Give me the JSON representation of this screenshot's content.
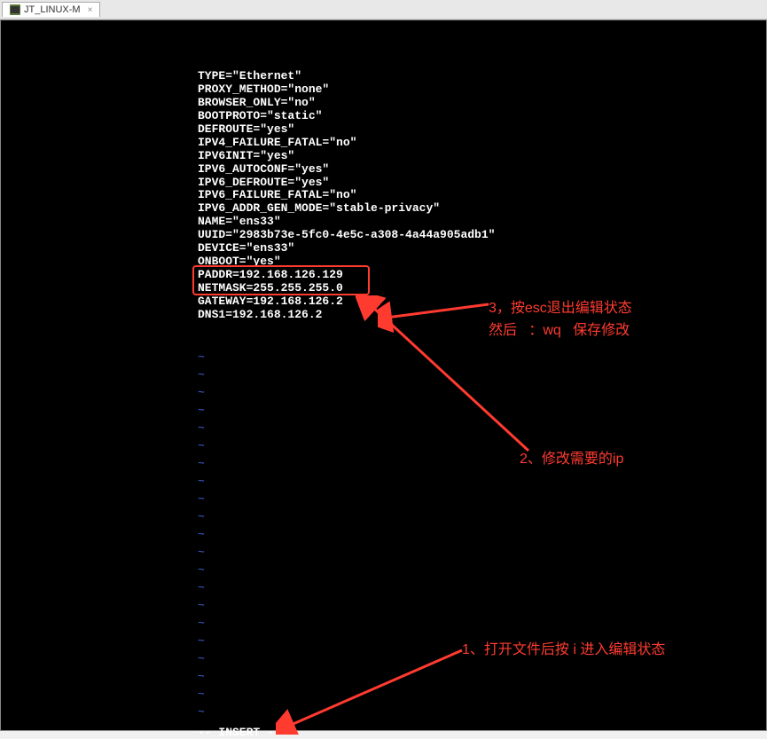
{
  "tab": {
    "label": "JT_LINUX-M",
    "close": "×"
  },
  "config": {
    "line1": "TYPE=\"Ethernet\"",
    "line2": "PROXY_METHOD=\"none\"",
    "line3": "BROWSER_ONLY=\"no\"",
    "line4": "BOOTPROTO=\"static\"",
    "line5": "DEFROUTE=\"yes\"",
    "line6": "IPV4_FAILURE_FATAL=\"no\"",
    "line7": "IPV6INIT=\"yes\"",
    "line8": "IPV6_AUTOCONF=\"yes\"",
    "line9": "IPV6_DEFROUTE=\"yes\"",
    "line10": "IPV6_FAILURE_FATAL=\"no\"",
    "line11": "IPV6_ADDR_GEN_MODE=\"stable-privacy\"",
    "line12": "NAME=\"ens33\"",
    "line13": "UUID=\"2983b73e-5fc0-4e5c-a308-4a44a905adb1\"",
    "line14": "DEVICE=\"ens33\"",
    "line15": "ONBOOT=\"yes\"",
    "line16": "PADDR=192.168.126.129",
    "line17": "NETMASK=255.255.255.0",
    "line18": "GATEWAY=192.168.126.2",
    "line19": "DNS1=192.168.126.2"
  },
  "tilde": "~",
  "insert_mode": "-- INSERT --",
  "annotations": {
    "step1": "1、打开文件后按 i 进入编辑状态",
    "step2": "2、修改需要的ip",
    "step3_line1": "3，按esc退出编辑状态",
    "step3_line2": "然后   ：wq   保存修改"
  }
}
